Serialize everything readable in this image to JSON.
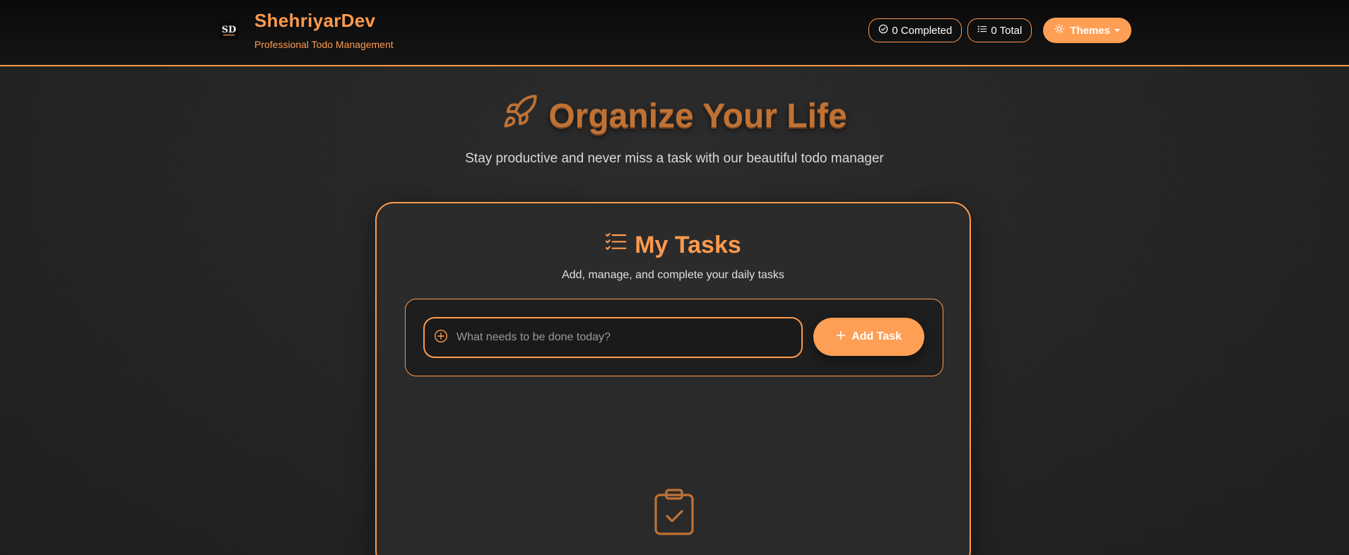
{
  "app": {
    "name": "ShehriyarDev",
    "tagline": "Professional Todo Management"
  },
  "stats": {
    "completed": "0 Completed",
    "total": "0 Total"
  },
  "themes_button": {
    "label": "Themes"
  },
  "hero": {
    "title": "Organize Your Life",
    "subtitle": "Stay productive and never miss a task with our beautiful todo manager"
  },
  "tasks_card": {
    "title": "My Tasks",
    "subtitle": "Add, manage, and complete your daily tasks",
    "input_placeholder": "What needs to be done today?",
    "add_button": "Add Task"
  },
  "icons": {
    "logo": "sd-logo",
    "completed": "check-circle-icon",
    "total": "list-icon",
    "themes": "sun-icon",
    "hero": "rocket-icon",
    "tasks": "checklist-icon",
    "input": "plus-circle-icon",
    "add": "plus-icon",
    "empty": "clipboard-check-icon"
  },
  "colors": {
    "accent": "#ff9a4d",
    "button": "#ff9f55",
    "hero_title": "#bf7235",
    "background": "#262626",
    "navbar": "#0a0a0a"
  }
}
